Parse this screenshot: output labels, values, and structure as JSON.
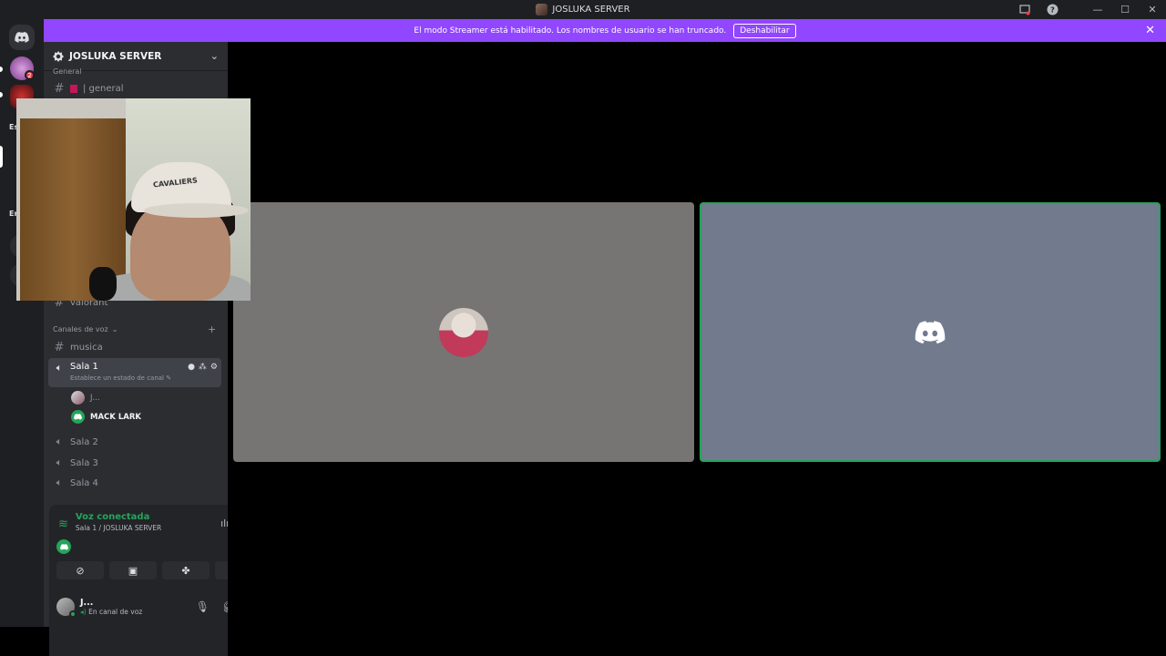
{
  "titlebar": {
    "title": "JOSLUKA SERVER"
  },
  "banner": {
    "message": "El modo Streamer está habilitado. Los nombres de usuario se han truncado.",
    "button_label": "Deshabilitar"
  },
  "rail": {
    "badge_count": "2",
    "folder_labels": [
      "Es",
      "En"
    ]
  },
  "sidebar": {
    "server_name": "JOSLUKA SERVER",
    "category_text": "General",
    "channel_general": "| general",
    "channel_valorant": "valorant",
    "voice_category": "Canales de voz",
    "channel_musica": "musica",
    "active_voice": {
      "name": "Sala 1",
      "status_prompt": "Establece un estado de canal"
    },
    "members": [
      {
        "name": "J..."
      },
      {
        "name": "MACK LARK"
      }
    ],
    "voice_channels": [
      "Sala 2",
      "Sala 3",
      "Sala 4"
    ]
  },
  "voice_panel": {
    "status": "Voz conectada",
    "location": "Sala 1 / JOSLUKA SERVER"
  },
  "user": {
    "name": "J...",
    "status": "En canal de voz"
  },
  "webcam": {
    "cap_text": "CAVALIERS"
  },
  "colors": {
    "banner": "#9146ff",
    "connected": "#23a55a",
    "tile_left": "#767574",
    "tile_right": "#727a8e"
  }
}
